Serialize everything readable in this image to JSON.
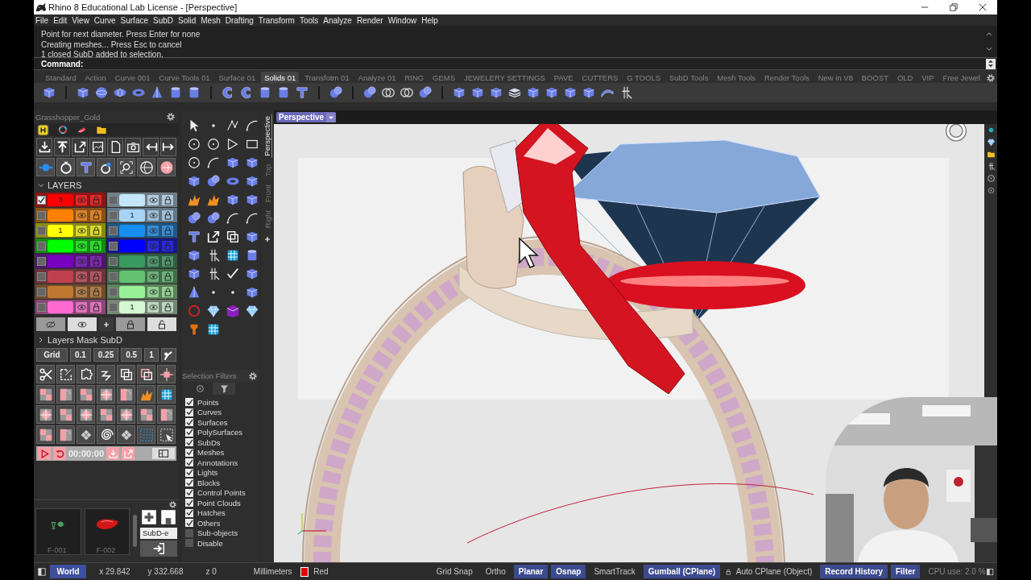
{
  "window": {
    "title": "Rhino 8 Educational Lab License - [Perspective]"
  },
  "menu": [
    "File",
    "Edit",
    "View",
    "Curve",
    "Surface",
    "SubD",
    "Solid",
    "Mesh",
    "Drafting",
    "Transform",
    "Tools",
    "Analyze",
    "Render",
    "Window",
    "Help"
  ],
  "command_history": [
    "Point for next diameter. Press Enter for none",
    "Creating meshes... Press Esc to cancel",
    "1 closed SubD added to selection."
  ],
  "command_prompt": "Command:",
  "toolbar_tabs": [
    {
      "label": "Standard",
      "selected": false
    },
    {
      "label": "Action",
      "selected": false
    },
    {
      "label": "Curve 001",
      "selected": false
    },
    {
      "label": "Curve Tools 01",
      "selected": false
    },
    {
      "label": "Surface 01",
      "selected": false
    },
    {
      "label": "Solids 01",
      "selected": true
    },
    {
      "label": "Transfotm 01",
      "selected": false
    },
    {
      "label": "Analyze 01",
      "selected": false
    },
    {
      "label": "RING",
      "selected": false
    },
    {
      "label": "GEMS",
      "selected": false
    },
    {
      "label": "JEWELERY SETTINGS",
      "selected": false
    },
    {
      "label": "PAVE",
      "selected": false
    },
    {
      "label": "CUTTERS",
      "selected": false
    },
    {
      "label": "G TOOLS",
      "selected": false
    },
    {
      "label": "SubD Tools",
      "selected": false
    },
    {
      "label": "Mesh Tools",
      "selected": false
    },
    {
      "label": "Render Tools",
      "selected": false
    },
    {
      "label": "New in V8",
      "selected": false
    },
    {
      "label": "BOOST",
      "selected": false
    },
    {
      "label": "OLD",
      "selected": false
    },
    {
      "label": "VIP",
      "selected": false
    },
    {
      "label": "Free Jewel",
      "selected": false
    }
  ],
  "panel": {
    "title": "Grasshopper_Gold"
  },
  "layers": {
    "title": "LAYERS",
    "expanded": true,
    "items": [
      {
        "color": "#ff0000",
        "checked": true,
        "label": "3"
      },
      {
        "color": "#c4e6fb",
        "checked": false
      },
      {
        "color": "#ff8000",
        "checked": false
      },
      {
        "color": "#a8d4f8",
        "checked": false,
        "label": "1"
      },
      {
        "color": "#ffff00",
        "checked": false,
        "label": "1"
      },
      {
        "color": "#168ef0",
        "checked": false
      },
      {
        "color": "#00ff00",
        "checked": false
      },
      {
        "color": "#0000ff",
        "checked": false
      },
      {
        "color": "#7800c0",
        "checked": false
      },
      {
        "color": "#3a9a60",
        "checked": false
      },
      {
        "color": "#c04050",
        "checked": false
      },
      {
        "color": "#62c070",
        "checked": false
      },
      {
        "color": "#c07830",
        "checked": false
      },
      {
        "color": "#98f098",
        "checked": false
      },
      {
        "color": "#ff6ad0",
        "checked": false
      },
      {
        "color": "#d4f8d4",
        "checked": false,
        "label": "1"
      }
    ]
  },
  "layers_mask": {
    "title": "Layers Mask SubD",
    "expanded": false
  },
  "grid_buttons": [
    "Grid",
    "0.1",
    "0.25",
    "0.5",
    "1"
  ],
  "timer": "00:00:00",
  "thumbnails": [
    {
      "label": "F-001"
    },
    {
      "label": "F-002"
    }
  ],
  "subd_label": "SubD-e",
  "selection_filters": {
    "title": "Selection Filters",
    "items": [
      {
        "label": "Points",
        "checked": true
      },
      {
        "label": "Curves",
        "checked": true
      },
      {
        "label": "Surfaces",
        "checked": true
      },
      {
        "label": "PolySurfaces",
        "checked": true
      },
      {
        "label": "SubDs",
        "checked": true
      },
      {
        "label": "Meshes",
        "checked": true
      },
      {
        "label": "Annotations",
        "checked": true
      },
      {
        "label": "Lights",
        "checked": true
      },
      {
        "label": "Blocks",
        "checked": true
      },
      {
        "label": "Control Points",
        "checked": true
      },
      {
        "label": "Point Clouds",
        "checked": true
      },
      {
        "label": "Hatches",
        "checked": true
      },
      {
        "label": "Others",
        "checked": true
      },
      {
        "label": "Sub-objects",
        "checked": false
      },
      {
        "label": "Disable",
        "checked": false
      }
    ]
  },
  "viewport_tabs": [
    {
      "label": "Perspective",
      "selected": true
    },
    {
      "label": "Top",
      "selected": false
    },
    {
      "label": "Front",
      "selected": false
    },
    {
      "label": "Right",
      "selected": false
    }
  ],
  "viewport": {
    "title": "Perspective"
  },
  "status_bar": {
    "cplane": "World",
    "x": "x 29.842",
    "y": "y 332.668",
    "z": "z 0",
    "units": "Millimeters",
    "layer": {
      "name": "Red",
      "color": "#e8000c"
    },
    "toggles_a": [
      {
        "label": "Grid Snap",
        "on": false
      },
      {
        "label": "Ortho",
        "on": false
      },
      {
        "label": "Planar",
        "on": true
      },
      {
        "label": "Osnap",
        "on": true
      },
      {
        "label": "SmartTrack",
        "on": false
      },
      {
        "label": "Gumball (CPlane)",
        "on": true
      }
    ],
    "auto_cplane": "Auto CPlane (Object)",
    "toggles_b": [
      {
        "label": "Record History",
        "on": true
      },
      {
        "label": "Filter",
        "on": true
      }
    ],
    "cpu": "CPU use: 2.0 %"
  }
}
